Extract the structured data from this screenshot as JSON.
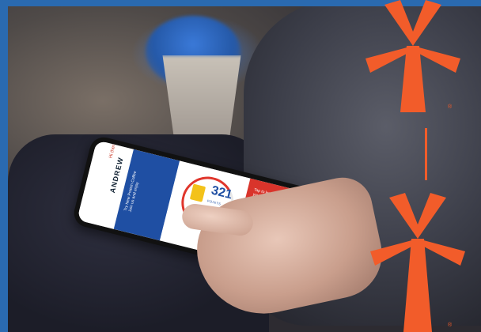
{
  "scene": {
    "app_screen": {
      "greeting": "Hi there",
      "user_name": "ANDREW",
      "promo_text": "Try New Protein Coffee",
      "promo_subtext": "Join us and enjoy",
      "points_value": "321",
      "points_label": "POINTS",
      "alert_text": "Tap to learn more about your rewards and offers."
    },
    "brand": {
      "logo": "windmill-logo",
      "registered_mark": "®",
      "colors": {
        "frame": "#2a6ab0",
        "orange": "#f25c2a",
        "blue": "#1f4fa3",
        "red": "#d9342b"
      }
    }
  }
}
